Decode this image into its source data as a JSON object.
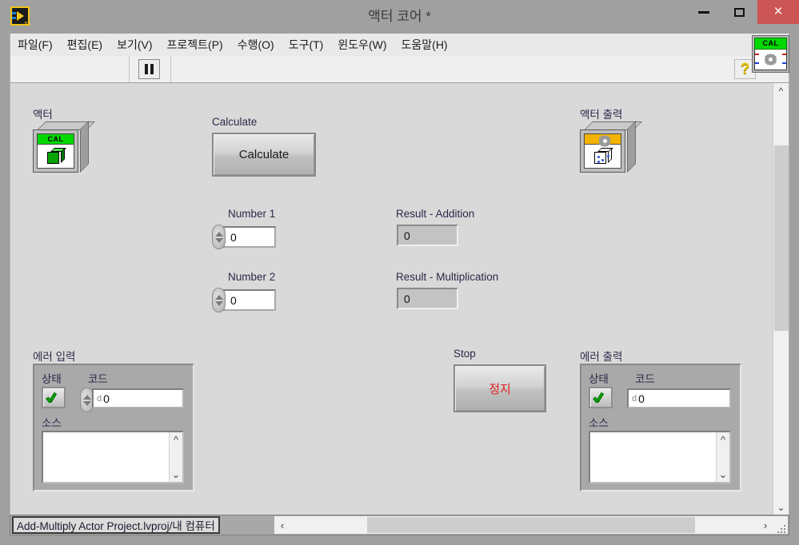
{
  "window": {
    "title": "액터 코어 *",
    "app_icon": "labview-icon",
    "app_icon_version": "15",
    "controls": {
      "minimize": "minimize-icon",
      "maximize": "maximize-icon",
      "close": "×"
    }
  },
  "menu": {
    "items": [
      {
        "label": "파일(F)",
        "name": "menu-file"
      },
      {
        "label": "편집(E)",
        "name": "menu-edit"
      },
      {
        "label": "보기(V)",
        "name": "menu-view"
      },
      {
        "label": "프로젝트(P)",
        "name": "menu-project"
      },
      {
        "label": "수행(O)",
        "name": "menu-operate"
      },
      {
        "label": "도구(T)",
        "name": "menu-tools"
      },
      {
        "label": "윈도우(W)",
        "name": "menu-window"
      },
      {
        "label": "도움말(H)",
        "name": "menu-help"
      }
    ]
  },
  "toolbar": {
    "pause_icon": "pause-icon",
    "help_icon": "?",
    "cal_badge_label": "CAL",
    "cal_badge_icon": "gear-icon"
  },
  "panel": {
    "actor_terminal": {
      "label": "액터",
      "badge": "CAL",
      "cube_color": "#05a405"
    },
    "actor_output_terminal": {
      "label": "액터 출력",
      "badge_icon": "gear-icon",
      "cube_color": "#2b4fd8"
    },
    "calculate": {
      "caption": "Calculate",
      "button_label": "Calculate"
    },
    "number1": {
      "label": "Number 1",
      "value": "0"
    },
    "number2": {
      "label": "Number 2",
      "value": "0"
    },
    "result_addition": {
      "label": "Result - Addition",
      "value": "0"
    },
    "result_multiplication": {
      "label": "Result - Multiplication",
      "value": "0"
    },
    "stop": {
      "caption": "Stop",
      "button_label": "정지"
    },
    "error_in": {
      "label": "에러 입력",
      "status_label": "상태",
      "status_value": "check-ok",
      "code_label": "코드",
      "code_prefix": "d",
      "code_value": "0",
      "source_label": "소스",
      "source_value": ""
    },
    "error_out": {
      "label": "에러 출력",
      "status_label": "상태",
      "status_value": "check-ok",
      "code_label": "코드",
      "code_prefix": "d",
      "code_value": "0",
      "source_label": "소스",
      "source_value": ""
    }
  },
  "statusbar": {
    "path": "Add-Multiply Actor Project.lvproj/내 컴퓨터",
    "scroll_left_icon": "‹",
    "scroll_right_icon": "›"
  },
  "scrollbars": {
    "v_up": "⌃",
    "v_down": "⌄"
  },
  "colors": {
    "title_bar": "#a0a0a0",
    "close_button": "#cc5555",
    "panel": "#d9d9d9",
    "cal_green": "#00d800",
    "gear_orange": "#f5b301",
    "stop_red": "#e02020"
  }
}
